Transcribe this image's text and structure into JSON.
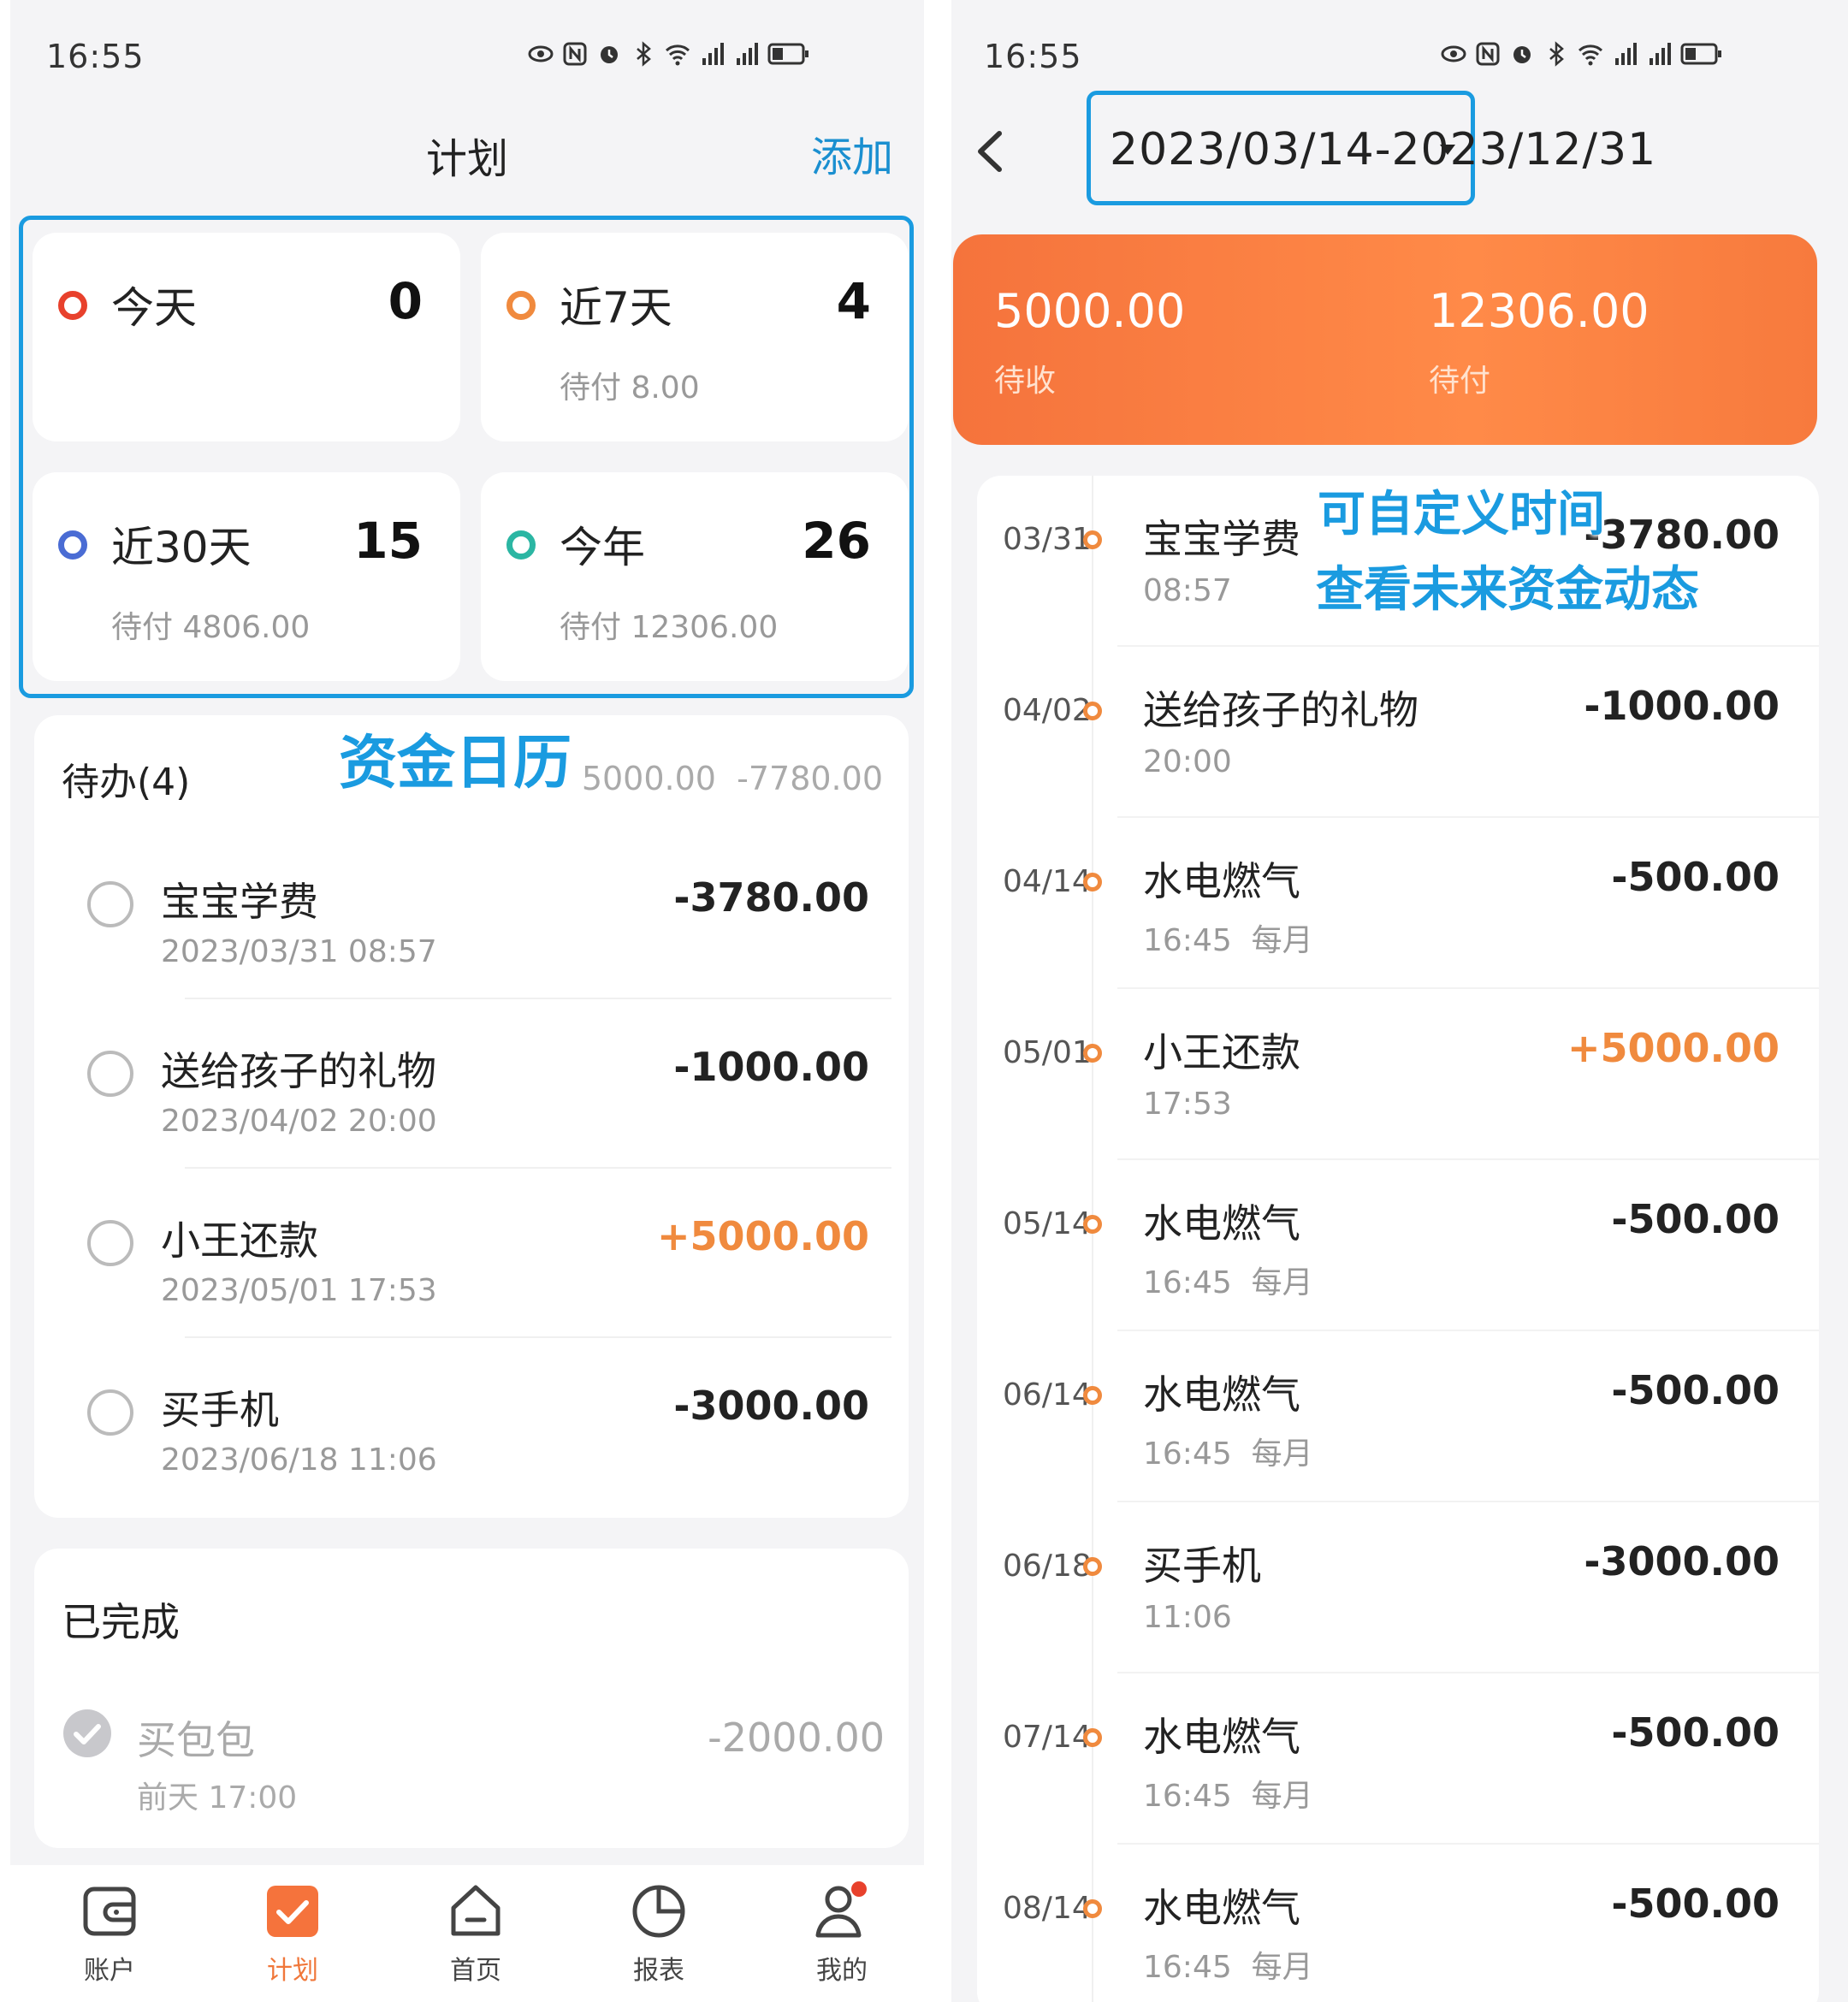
{
  "status": {
    "time": "16:55"
  },
  "left": {
    "title": "计划",
    "add_label": "添加",
    "cards": [
      {
        "label": "今天",
        "count": "0",
        "sub": "",
        "color": "#e8412c"
      },
      {
        "label": "近7天",
        "count": "4",
        "sub": "待付 8.00",
        "color": "#f08a3e"
      },
      {
        "label": "近30天",
        "count": "15",
        "sub": "待付 4806.00",
        "color": "#4a6cd4"
      },
      {
        "label": "今年",
        "count": "26",
        "sub": "待付 12306.00",
        "color": "#2bb6a3"
      }
    ],
    "annotation": "资金日历",
    "todo": {
      "header": "待办(4)",
      "income": "5000.00",
      "expense": "-7780.00",
      "items": [
        {
          "name": "宝宝学费",
          "date": "2023/03/31 08:57",
          "amount": "-3780.00"
        },
        {
          "name": "送给孩子的礼物",
          "date": "2023/04/02 20:00",
          "amount": "-1000.00"
        },
        {
          "name": "小王还款",
          "date": "2023/05/01 17:53",
          "amount": "+5000.00"
        },
        {
          "name": "买手机",
          "date": "2023/06/18 11:06",
          "amount": "-3000.00"
        }
      ]
    },
    "done": {
      "header": "已完成",
      "item": {
        "name": "买包包",
        "time": "前天 17:00",
        "amount": "-2000.00"
      }
    },
    "tabs": [
      {
        "label": "账户",
        "icon": "wallet-icon"
      },
      {
        "label": "计划",
        "icon": "check-square-icon"
      },
      {
        "label": "首页",
        "icon": "home-icon"
      },
      {
        "label": "报表",
        "icon": "pie-chart-icon"
      },
      {
        "label": "我的",
        "icon": "user-icon"
      }
    ]
  },
  "right": {
    "range": "2023/03/14-2023/12/31",
    "income": {
      "value": "5000.00",
      "label": "待收"
    },
    "expense": {
      "value": "12306.00",
      "label": "待付"
    },
    "annotation_line1": "可自定义时间",
    "annotation_line2": "查看未来资金动态",
    "rows": [
      {
        "date": "03/31",
        "name": "宝宝学费",
        "sub": "08:57",
        "amount": "-3780.00"
      },
      {
        "date": "04/02",
        "name": "送给孩子的礼物",
        "sub": "20:00",
        "amount": "-1000.00"
      },
      {
        "date": "04/14",
        "name": "水电燃气",
        "sub": "16:45  每月",
        "amount": "-500.00"
      },
      {
        "date": "05/01",
        "name": "小王还款",
        "sub": "17:53",
        "amount": "+5000.00"
      },
      {
        "date": "05/14",
        "name": "水电燃气",
        "sub": "16:45  每月",
        "amount": "-500.00"
      },
      {
        "date": "06/14",
        "name": "水电燃气",
        "sub": "16:45  每月",
        "amount": "-500.00"
      },
      {
        "date": "06/18",
        "name": "买手机",
        "sub": "11:06",
        "amount": "-3000.00"
      },
      {
        "date": "07/14",
        "name": "水电燃气",
        "sub": "16:45  每月",
        "amount": "-500.00"
      },
      {
        "date": "08/14",
        "name": "水电燃气",
        "sub": "16:45  每月",
        "amount": "-500.00"
      }
    ]
  },
  "colors": {
    "accent": "#1a9be0",
    "orange": "#f08a3e",
    "banner": "#f5733c"
  }
}
